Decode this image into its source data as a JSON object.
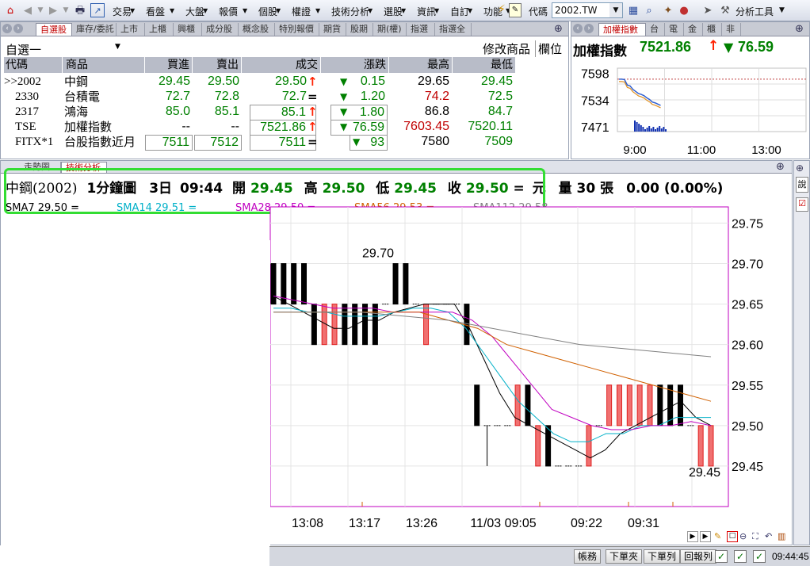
{
  "menubar": {
    "items": [
      "交易",
      "看盤",
      "大盤",
      "報價",
      "個股",
      "權證",
      "技術分析",
      "選股",
      "資訊",
      "自訂",
      "功能"
    ],
    "code_label": "代碼",
    "code_value": "2002.TW",
    "analysis_tools": "分析工具"
  },
  "quote_panel": {
    "tabs": [
      "自選股",
      "庫存/委託",
      "上市",
      "上櫃",
      "興櫃",
      "成分股",
      "概念股",
      "特別報價",
      "期貨",
      "股期",
      "期(權)",
      "指選",
      "指選全"
    ],
    "group_name": "自選一",
    "edit_label": "修改商品",
    "field_label": "欄位",
    "columns": [
      "代碼",
      "商品",
      "買進",
      "賣出",
      "成交",
      "漲跌",
      "最高",
      "最低"
    ],
    "rows": [
      {
        "code": ">>2002",
        "name": "中鋼",
        "bid": "29.45",
        "ask": "29.50",
        "last": "29.50",
        "last_mark": "↑",
        "chg": "0.15",
        "high": "29.65",
        "low": "29.45"
      },
      {
        "code": "2330",
        "name": "台積電",
        "bid": "72.7",
        "ask": "72.8",
        "last": "72.7",
        "last_mark": "=",
        "chg": "1.20",
        "high": "74.2",
        "low": "72.5"
      },
      {
        "code": "2317",
        "name": "鴻海",
        "bid": "85.0",
        "ask": "85.1",
        "last": "85.1",
        "last_mark": "↑",
        "chg": "1.80",
        "high": "86.8",
        "low": "84.7"
      },
      {
        "code": "TSE",
        "name": "加權指數",
        "bid": "--",
        "ask": "--",
        "last": "7521.86",
        "last_mark": "↑",
        "chg": "76.59",
        "high": "7603.45",
        "low": "7520.11"
      },
      {
        "code": "FITX*1",
        "name": "台股指數近月",
        "bid": "7511",
        "ask": "7512",
        "last": "7511",
        "last_mark": "=",
        "chg": "93",
        "high": "7580",
        "low": "7509"
      }
    ]
  },
  "index_panel": {
    "tabs": [
      "加權指數",
      "台",
      "電",
      "金",
      "櫃",
      "非"
    ],
    "title": "加權指數",
    "value": "7521.86",
    "change": "76.59",
    "y_labels": [
      "7598",
      "7534",
      "7471"
    ],
    "x_labels": [
      "9:00",
      "11:00",
      "13:00"
    ],
    "colors": {
      "accent": "#ff3300",
      "green": "#008000"
    }
  },
  "tech_panel": {
    "tabs": [
      "走勢圖",
      "技術分析"
    ],
    "info": {
      "name": "中鋼(2002)",
      "period": "1分鐘圖",
      "days": "3日",
      "time": "09:44",
      "open_label": "開",
      "open": "29.45",
      "high_label": "高",
      "high": "29.50",
      "low_label": "低",
      "low": "29.45",
      "close_label": "收",
      "close": "29.50",
      "eq": "=",
      "unit": "元",
      "vol_label": "量",
      "vol": "30",
      "vol_unit": "張",
      "pct": "0.00 (0.00%)"
    },
    "sma": [
      {
        "label": "SMA7 29.50 =",
        "color": "#000000"
      },
      {
        "label": "SMA14 29.51 =",
        "color": "#00b0c8"
      },
      {
        "label": "SMA28 29.50 =",
        "color": "#c000c0"
      },
      {
        "label": "SMA56 29.53 =",
        "color": "#d06000"
      },
      {
        "label": "SMA112 29.58",
        "color": "#808080"
      }
    ],
    "y_ticks": [
      "29.75",
      "29.70",
      "29.65",
      "29.60",
      "29.55",
      "29.50",
      "29.45"
    ],
    "x_ticks": [
      "13:08",
      "13:17",
      "13:26",
      "11/03 09:05",
      "09:22",
      "09:31"
    ],
    "max_annot": "29.70",
    "min_annot": "29.45"
  },
  "chart_data": {
    "type": "candlestick",
    "title": "中鋼(2002) 1分鐘圖",
    "y_range": [
      29.4,
      29.77
    ],
    "candles": [
      {
        "o": 29.7,
        "c": 29.65,
        "h": 29.7,
        "l": 29.65
      },
      {
        "o": 29.7,
        "c": 29.65,
        "h": 29.7,
        "l": 29.65
      },
      {
        "o": 29.7,
        "c": 29.65,
        "h": 29.7,
        "l": 29.65
      },
      {
        "o": 29.7,
        "c": 29.65,
        "h": 29.7,
        "l": 29.65
      },
      {
        "o": 29.65,
        "c": 29.6,
        "h": 29.65,
        "l": 29.6
      },
      {
        "o": 29.6,
        "c": 29.65,
        "h": 29.65,
        "l": 29.6
      },
      {
        "o": 29.6,
        "c": 29.65,
        "h": 29.65,
        "l": 29.6
      },
      {
        "o": 29.65,
        "c": 29.6,
        "h": 29.65,
        "l": 29.6
      },
      {
        "o": 29.65,
        "c": 29.6,
        "h": 29.65,
        "l": 29.6
      },
      {
        "o": 29.65,
        "c": 29.6,
        "h": 29.65,
        "l": 29.6
      },
      {
        "o": 29.65,
        "c": 29.6,
        "h": 29.65,
        "l": 29.6
      },
      {
        "o": 29.65,
        "c": 29.65,
        "h": 29.65,
        "l": 29.65
      },
      {
        "o": 29.7,
        "c": 29.65,
        "h": 29.7,
        "l": 29.65
      },
      {
        "o": 29.7,
        "c": 29.65,
        "h": 29.7,
        "l": 29.65
      },
      {
        "o": 29.65,
        "c": 29.65,
        "h": 29.65,
        "l": 29.65
      },
      {
        "o": 29.6,
        "c": 29.65,
        "h": 29.65,
        "l": 29.6
      },
      {
        "o": 29.65,
        "c": 29.65,
        "h": 29.65,
        "l": 29.65
      },
      {
        "o": 29.65,
        "c": 29.65,
        "h": 29.65,
        "l": 29.65
      },
      {
        "o": 29.65,
        "c": 29.65,
        "h": 29.65,
        "l": 29.65
      },
      {
        "o": 29.65,
        "c": 29.6,
        "h": 29.65,
        "l": 29.6
      },
      {
        "o": 29.55,
        "c": 29.5,
        "h": 29.55,
        "l": 29.5
      },
      {
        "o": 29.5,
        "c": 29.5,
        "h": 29.5,
        "l": 29.45
      },
      {
        "o": 29.5,
        "c": 29.5,
        "h": 29.5,
        "l": 29.5
      },
      {
        "o": 29.5,
        "c": 29.5,
        "h": 29.5,
        "l": 29.5
      },
      {
        "o": 29.5,
        "c": 29.55,
        "h": 29.55,
        "l": 29.5
      },
      {
        "o": 29.55,
        "c": 29.5,
        "h": 29.55,
        "l": 29.5
      },
      {
        "o": 29.45,
        "c": 29.5,
        "h": 29.5,
        "l": 29.45
      },
      {
        "o": 29.5,
        "c": 29.45,
        "h": 29.5,
        "l": 29.45
      },
      {
        "o": 29.45,
        "c": 29.45,
        "h": 29.45,
        "l": 29.45
      },
      {
        "o": 29.45,
        "c": 29.45,
        "h": 29.45,
        "l": 29.45
      },
      {
        "o": 29.45,
        "c": 29.45,
        "h": 29.45,
        "l": 29.45
      },
      {
        "o": 29.45,
        "c": 29.5,
        "h": 29.5,
        "l": 29.45
      },
      {
        "o": 29.5,
        "c": 29.5,
        "h": 29.5,
        "l": 29.5
      },
      {
        "o": 29.5,
        "c": 29.55,
        "h": 29.55,
        "l": 29.5
      },
      {
        "o": 29.5,
        "c": 29.55,
        "h": 29.55,
        "l": 29.5
      },
      {
        "o": 29.5,
        "c": 29.55,
        "h": 29.55,
        "l": 29.5
      },
      {
        "o": 29.5,
        "c": 29.55,
        "h": 29.55,
        "l": 29.5
      },
      {
        "o": 29.5,
        "c": 29.55,
        "h": 29.55,
        "l": 29.5
      },
      {
        "o": 29.55,
        "c": 29.5,
        "h": 29.55,
        "l": 29.5
      },
      {
        "o": 29.55,
        "c": 29.5,
        "h": 29.55,
        "l": 29.5
      },
      {
        "o": 29.55,
        "c": 29.5,
        "h": 29.55,
        "l": 29.5
      },
      {
        "o": 29.5,
        "c": 29.5,
        "h": 29.5,
        "l": 29.5
      },
      {
        "o": 29.45,
        "c": 29.5,
        "h": 29.5,
        "l": 29.45
      },
      {
        "o": 29.45,
        "c": 29.5,
        "h": 29.5,
        "l": 29.45
      }
    ],
    "series": [
      {
        "name": "SMA7",
        "color": "#000000",
        "values": [
          29.66,
          29.65,
          29.64,
          29.63,
          29.62,
          29.62,
          29.63,
          29.63,
          29.64,
          29.645,
          29.65,
          29.65,
          29.65,
          29.62,
          29.58,
          29.54,
          29.51,
          29.5,
          29.49,
          29.48,
          29.47,
          29.46,
          29.47,
          29.49,
          29.5,
          29.51,
          29.52,
          29.53,
          29.51,
          29.5
        ]
      },
      {
        "name": "SMA14",
        "color": "#00b0c8",
        "values": [
          29.645,
          29.645,
          29.64,
          29.64,
          29.635,
          29.635,
          29.635,
          29.64,
          29.645,
          29.645,
          29.64,
          29.62,
          29.59,
          29.56,
          29.53,
          29.51,
          29.49,
          29.48,
          29.48,
          29.49,
          29.49,
          29.5,
          29.5,
          29.51,
          29.51,
          29.51
        ]
      },
      {
        "name": "SMA28",
        "color": "#c000c0",
        "values": [
          29.66,
          29.655,
          29.65,
          29.645,
          29.645,
          29.645,
          29.64,
          29.64,
          29.64,
          29.64,
          29.63,
          29.61,
          29.58,
          29.55,
          29.52,
          29.51,
          29.5,
          29.495,
          29.495,
          29.5,
          29.5,
          29.505,
          29.5
        ]
      },
      {
        "name": "SMA56",
        "color": "#d06000",
        "values": [
          29.64,
          29.64,
          29.64,
          29.64,
          29.64,
          29.64,
          29.63,
          29.62,
          29.6,
          29.59,
          29.58,
          29.57,
          29.56,
          29.55,
          29.54,
          29.53
        ]
      },
      {
        "name": "SMA112",
        "color": "#808080",
        "values": [
          29.64,
          29.64,
          29.64,
          29.635,
          29.63,
          29.62,
          29.61,
          29.6,
          29.595,
          29.59,
          29.585
        ]
      }
    ],
    "index_series": [
      7584,
      7584,
      7583,
      7570,
      7568,
      7560,
      7555,
      7550,
      7548,
      7545,
      7540,
      7536,
      7530,
      7528,
      7525,
      7522
    ]
  },
  "statusbar": {
    "buttons": [
      "帳務",
      "下單夾",
      "下單列",
      "回報列"
    ],
    "time": "09:44:45"
  }
}
